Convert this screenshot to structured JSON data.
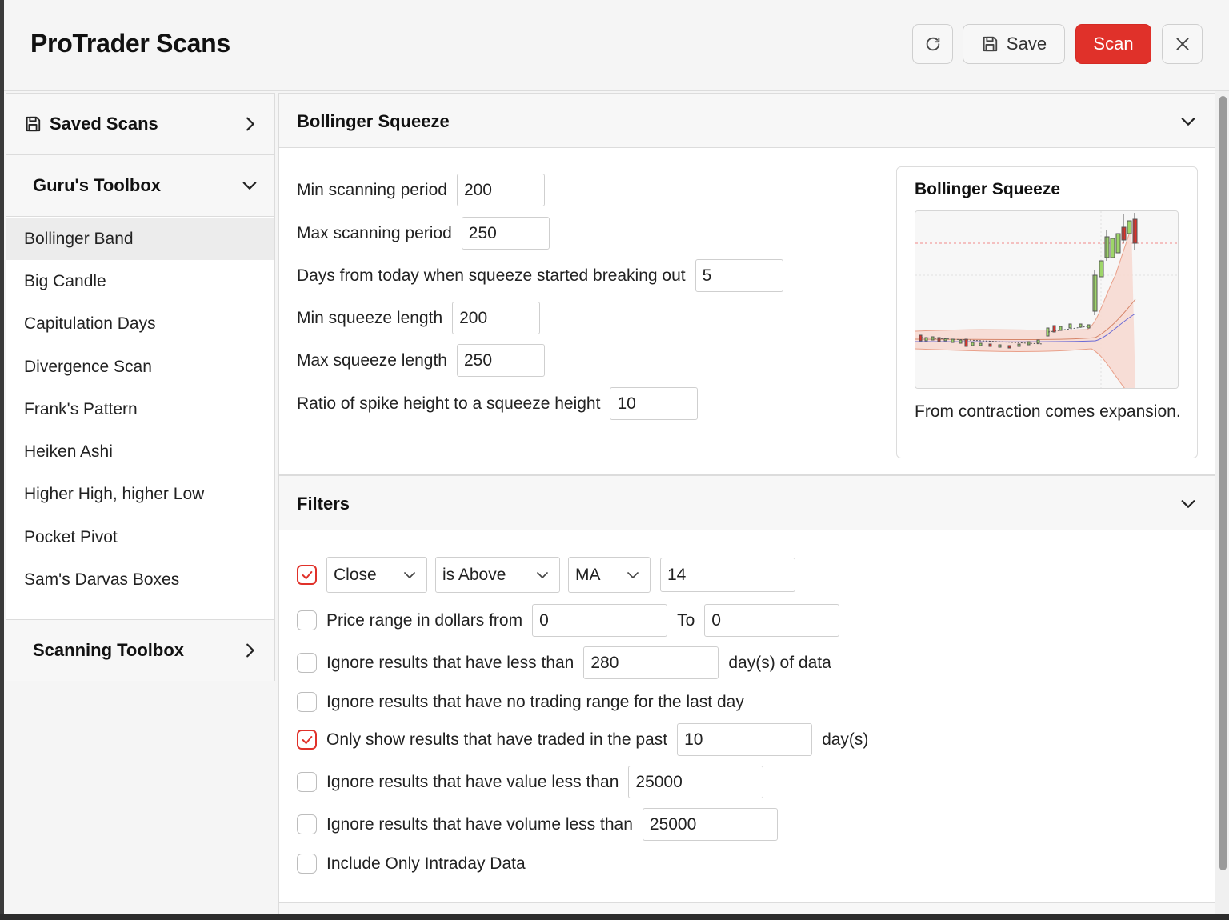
{
  "header": {
    "title": "ProTrader Scans",
    "save_label": "Save",
    "scan_label": "Scan",
    "scan_color": "#e0312a"
  },
  "sidebar": {
    "saved_scans": "Saved Scans",
    "gurus_toolbox": "Guru's Toolbox",
    "items": [
      {
        "label": "Bollinger Band",
        "active": true
      },
      {
        "label": "Big Candle"
      },
      {
        "label": "Capitulation Days"
      },
      {
        "label": "Divergence Scan"
      },
      {
        "label": "Frank's Pattern"
      },
      {
        "label": "Heiken Ashi"
      },
      {
        "label": "Higher High, higher Low"
      },
      {
        "label": "Pocket Pivot"
      },
      {
        "label": "Sam's Darvas Boxes"
      }
    ],
    "scanning_toolbox": "Scanning Toolbox"
  },
  "bollinger": {
    "title": "Bollinger Squeeze",
    "params": [
      {
        "label": "Min scanning period",
        "value": "200"
      },
      {
        "label": "Max scanning period",
        "value": "250"
      },
      {
        "label": "Days from today when squeeze started breaking out",
        "value": "5"
      },
      {
        "label": "Min squeeze length",
        "value": "200"
      },
      {
        "label": "Max squeeze length",
        "value": "250"
      },
      {
        "label": "Ratio of spike height to a squeeze height",
        "value": "10"
      }
    ],
    "preview": {
      "title": "Bollinger Squeeze",
      "description": "From contraction comes expansion."
    }
  },
  "filters": {
    "title": "Filters",
    "condition": {
      "checked": true,
      "field": "Close",
      "operator": "is Above",
      "indicator": "MA",
      "value": "14"
    },
    "price_range": {
      "checked": false,
      "label": "Price range in dollars from",
      "from": "0",
      "to_label": "To",
      "to": "0"
    },
    "min_data": {
      "checked": false,
      "label": "Ignore results that have less than",
      "value": "280",
      "suffix": "day(s) of data"
    },
    "no_range": {
      "checked": false,
      "label": "Ignore results that have no trading range for the last day"
    },
    "traded_past": {
      "checked": true,
      "label": "Only show results that have traded in the past",
      "value": "10",
      "suffix": "day(s)"
    },
    "min_value": {
      "checked": false,
      "label": "Ignore results that have value less than",
      "value": "25000"
    },
    "min_volume": {
      "checked": false,
      "label": "Ignore results that have volume less than",
      "value": "25000"
    },
    "intraday": {
      "checked": false,
      "label": "Include Only Intraday Data"
    }
  }
}
